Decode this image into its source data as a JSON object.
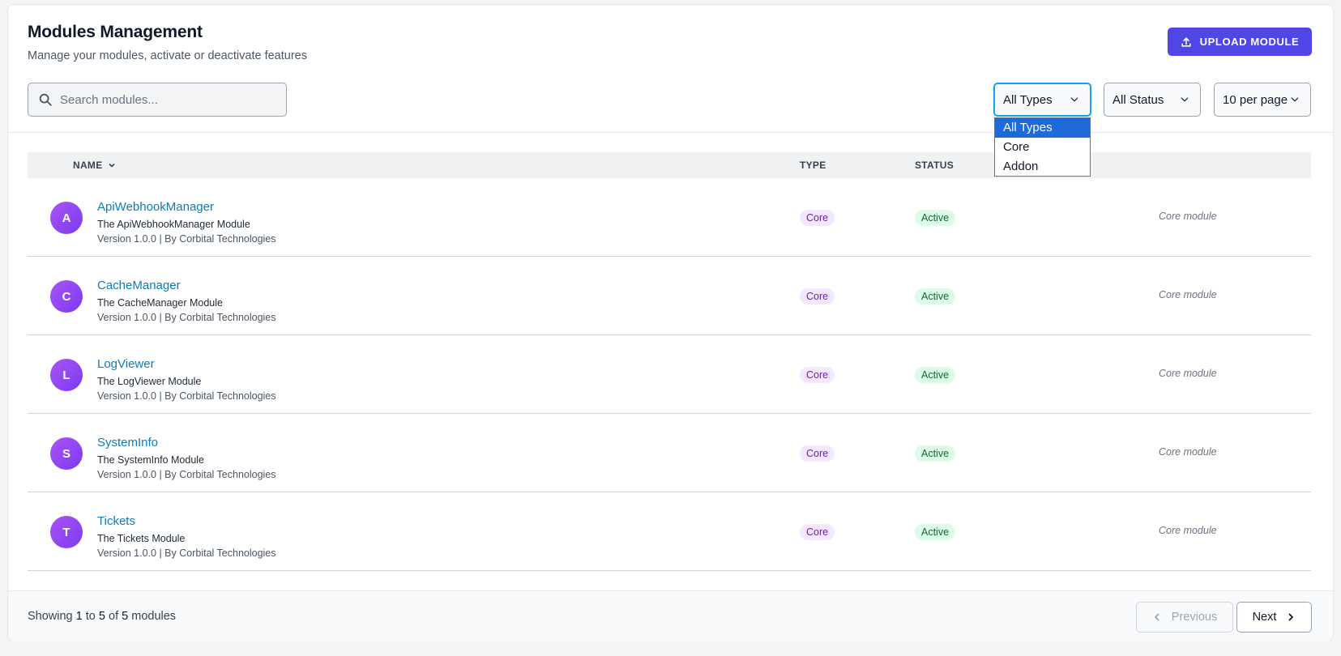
{
  "header": {
    "title": "Modules Management",
    "subtitle": "Manage your modules, activate or deactivate features",
    "upload_label": "UPLOAD MODULE"
  },
  "search": {
    "placeholder": "Search modules...",
    "value": ""
  },
  "filters": {
    "type": {
      "selected": "All Types",
      "options": [
        "All Types",
        "Core",
        "Addon"
      ],
      "open": true
    },
    "status": {
      "selected": "All Status"
    },
    "per_page": {
      "selected": "10 per page"
    }
  },
  "table": {
    "columns": {
      "name": "NAME",
      "type": "TYPE",
      "status": "STATUS"
    },
    "rows": [
      {
        "initial": "A",
        "name": "ApiWebhookManager",
        "description": "The ApiWebhookManager Module",
        "meta": "Version 1.0.0 | By Corbital Technologies",
        "type": "Core",
        "status": "Active",
        "note": "Core module"
      },
      {
        "initial": "C",
        "name": "CacheManager",
        "description": "The CacheManager Module",
        "meta": "Version 1.0.0 | By Corbital Technologies",
        "type": "Core",
        "status": "Active",
        "note": "Core module"
      },
      {
        "initial": "L",
        "name": "LogViewer",
        "description": "The LogViewer Module",
        "meta": "Version 1.0.0 | By Corbital Technologies",
        "type": "Core",
        "status": "Active",
        "note": "Core module"
      },
      {
        "initial": "S",
        "name": "SystemInfo",
        "description": "The SystemInfo Module",
        "meta": "Version 1.0.0 | By Corbital Technologies",
        "type": "Core",
        "status": "Active",
        "note": "Core module"
      },
      {
        "initial": "T",
        "name": "Tickets",
        "description": "The Tickets Module",
        "meta": "Version 1.0.0 | By Corbital Technologies",
        "type": "Core",
        "status": "Active",
        "note": "Core module"
      }
    ]
  },
  "footer": {
    "showing_prefix": "Showing",
    "from": "1",
    "to_word": "to",
    "to": "5",
    "of_word": "of",
    "total": "5",
    "suffix": "modules",
    "prev_label": "Previous",
    "next_label": "Next"
  },
  "colors": {
    "accent": "#4f46e5",
    "link": "#0e7bb8",
    "type_badge_bg": "#f3e8ff",
    "status_badge_bg": "#dcfce7",
    "dropdown_selected": "#1d6ad8"
  },
  "icons": {
    "upload": "upload-icon",
    "search": "search-icon",
    "chevron": "chevron-down-icon",
    "sort": "sort-chevron-icon",
    "prev": "chevron-left-icon",
    "next": "chevron-right-icon"
  }
}
